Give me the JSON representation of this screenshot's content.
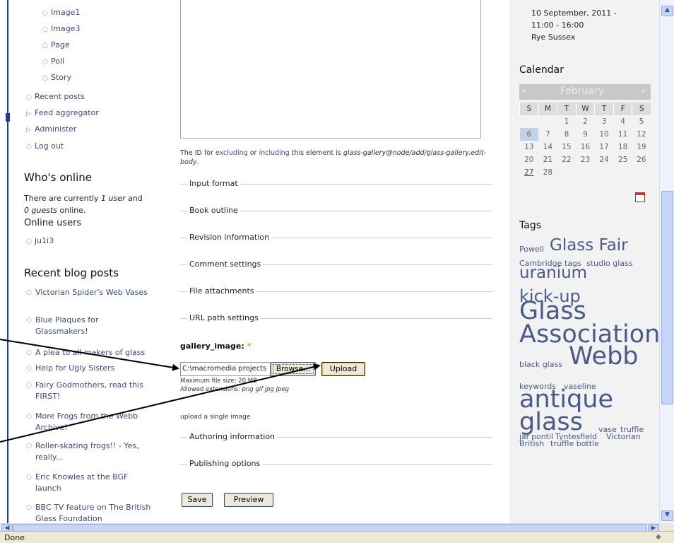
{
  "left": {
    "nav_sub": [
      "Image1",
      "Image3",
      "Page",
      "Poll",
      "Story"
    ],
    "nav_main": [
      {
        "label": "Recent posts",
        "bullet": "circle"
      },
      {
        "label": "Feed aggregator",
        "bullet": "triangle"
      },
      {
        "label": "Administer",
        "bullet": "triangle"
      },
      {
        "label": "Log out",
        "bullet": "circle"
      }
    ],
    "whos_online": {
      "title": "Who's online",
      "line1_pre": "There are currently ",
      "line1_users": "1 user",
      "line1_post": " and",
      "line2_guests": "0 guests",
      "line2_post": " online.",
      "online_users_label": "Online users",
      "users": [
        "ju1i3"
      ]
    },
    "recent_blog": {
      "title": "Recent blog posts",
      "posts": [
        "Victorian Spider's Web Vases",
        "Blue Plaques for Glassmakers!",
        "A plea to all makers of glass",
        "Help for Ugly Sisters",
        "Fairy Godmothers, read this FIRST!",
        "More Frogs from the Webb Archive!",
        "Roller-skating frogs!! - Yes, really...",
        "Eric Knowles at the BGF launch",
        "BBC TV feature on The British Glass Foundation"
      ]
    }
  },
  "center": {
    "id_note_pre": "The ID for ",
    "id_note_link1": "excluding",
    "id_note_or": " or ",
    "id_note_link2": "including",
    "id_note_mid": " this element is ",
    "id_note_id": "glass-gallery@node/add/glass-gallery.edit-body",
    "id_note_end": ".",
    "fieldsets": [
      "Input format",
      "Book outline",
      "Revision information",
      "Comment settings",
      "File attachments",
      "URL path settings"
    ],
    "gallery_label": "gallery_image:",
    "required_mark": "*",
    "file_value": "C:\\macromedia projects",
    "browse_label": "Browse...",
    "upload_label": "Upload",
    "max_size": "Maximum file size: 20 MB",
    "allowed_pre": "Allowed extensions: ",
    "allowed_ext": "png gif jpg jpeg",
    "upload_hint": "upload a single image",
    "fieldsets2": [
      "Authoring information",
      "Publishing options"
    ],
    "save_label": "Save",
    "preview_label": "Preview"
  },
  "right": {
    "event": [
      "10 September, 2011 -",
      "11:00 - 16:00",
      "Rye Sussex"
    ],
    "calendar": {
      "title": "Calendar",
      "prev": "«",
      "month": "February",
      "next": "»",
      "weekdays": [
        "S",
        "M",
        "T",
        "W",
        "T",
        "F",
        "S"
      ],
      "weeks": [
        [
          "",
          "",
          "1",
          "2",
          "3",
          "4",
          "5"
        ],
        [
          "6",
          "7",
          "8",
          "9",
          "10",
          "11",
          "12"
        ],
        [
          "13",
          "14",
          "15",
          "16",
          "17",
          "18",
          "19"
        ],
        [
          "20",
          "21",
          "22",
          "23",
          "24",
          "25",
          "26"
        ],
        [
          "27",
          "28",
          "",
          "",
          "",
          "",
          ""
        ]
      ],
      "today": "6",
      "linked": "27"
    },
    "tags_title": "Tags",
    "tags": [
      "Powell",
      "Glass Fair",
      "Cambridge",
      "tags",
      "studio glass",
      "uranium",
      "kick-up",
      "Glass Association",
      "black glass",
      "Webb",
      "keywords",
      "vaseline",
      "antique glass",
      "vase",
      "truffle",
      "jar",
      "pontil",
      "Tyntesfield",
      "Victorian",
      "British",
      "truffle bottle"
    ]
  },
  "status": {
    "text": "Done"
  },
  "colors": {
    "link": "#3a4a7a",
    "sidebar_edge": "#1a3d9a",
    "today": "#c2d3e6",
    "accent_required": "#e0a020"
  }
}
